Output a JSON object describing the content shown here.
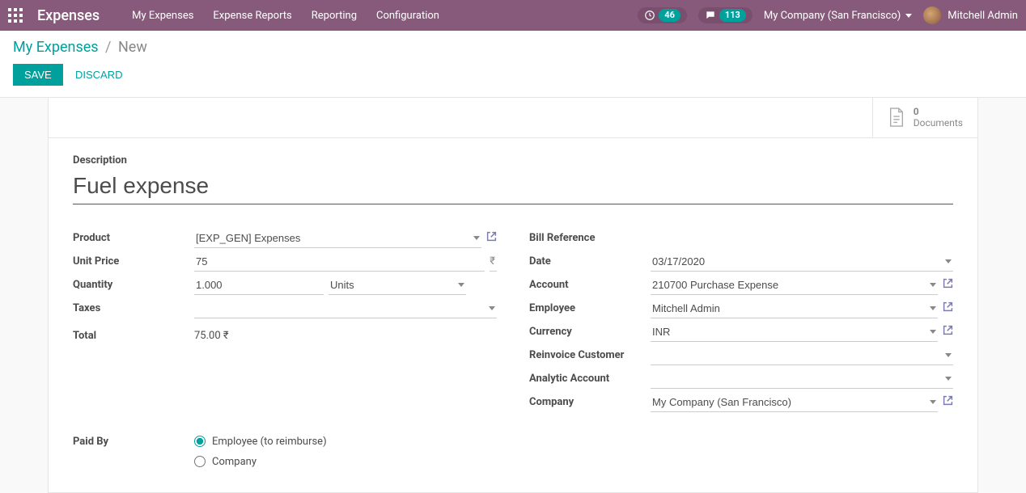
{
  "topbar": {
    "brand": "Expenses",
    "menu": [
      "My Expenses",
      "Expense Reports",
      "Reporting",
      "Configuration"
    ],
    "activity_count": "46",
    "message_count": "113",
    "company": "My Company (San Francisco)",
    "user": "Mitchell Admin"
  },
  "breadcrumb": {
    "parent": "My Expenses",
    "current": "New"
  },
  "actions": {
    "save": "SAVE",
    "discard": "DISCARD"
  },
  "docs": {
    "count": "0",
    "label": "Documents"
  },
  "form": {
    "description_label": "Description",
    "description": "Fuel expense",
    "left": {
      "product_label": "Product",
      "product": "[EXP_GEN] Expenses",
      "unit_price_label": "Unit Price",
      "unit_price": "75",
      "currency_symbol": "₹",
      "quantity_label": "Quantity",
      "quantity": "1.000",
      "uom": "Units",
      "taxes_label": "Taxes",
      "taxes": "",
      "total_label": "Total",
      "total": "75.00 ₹"
    },
    "right": {
      "bill_ref_label": "Bill Reference",
      "bill_ref": "",
      "date_label": "Date",
      "date": "03/17/2020",
      "account_label": "Account",
      "account": "210700 Purchase Expense",
      "employee_label": "Employee",
      "employee": "Mitchell Admin",
      "currency_label": "Currency",
      "currency": "INR",
      "reinvoice_label": "Reinvoice Customer",
      "reinvoice": "",
      "analytic_label": "Analytic Account",
      "analytic": "",
      "company_label": "Company",
      "company": "My Company (San Francisco)"
    },
    "paid_by": {
      "label": "Paid By",
      "opt_employee": "Employee (to reimburse)",
      "opt_company": "Company"
    }
  }
}
